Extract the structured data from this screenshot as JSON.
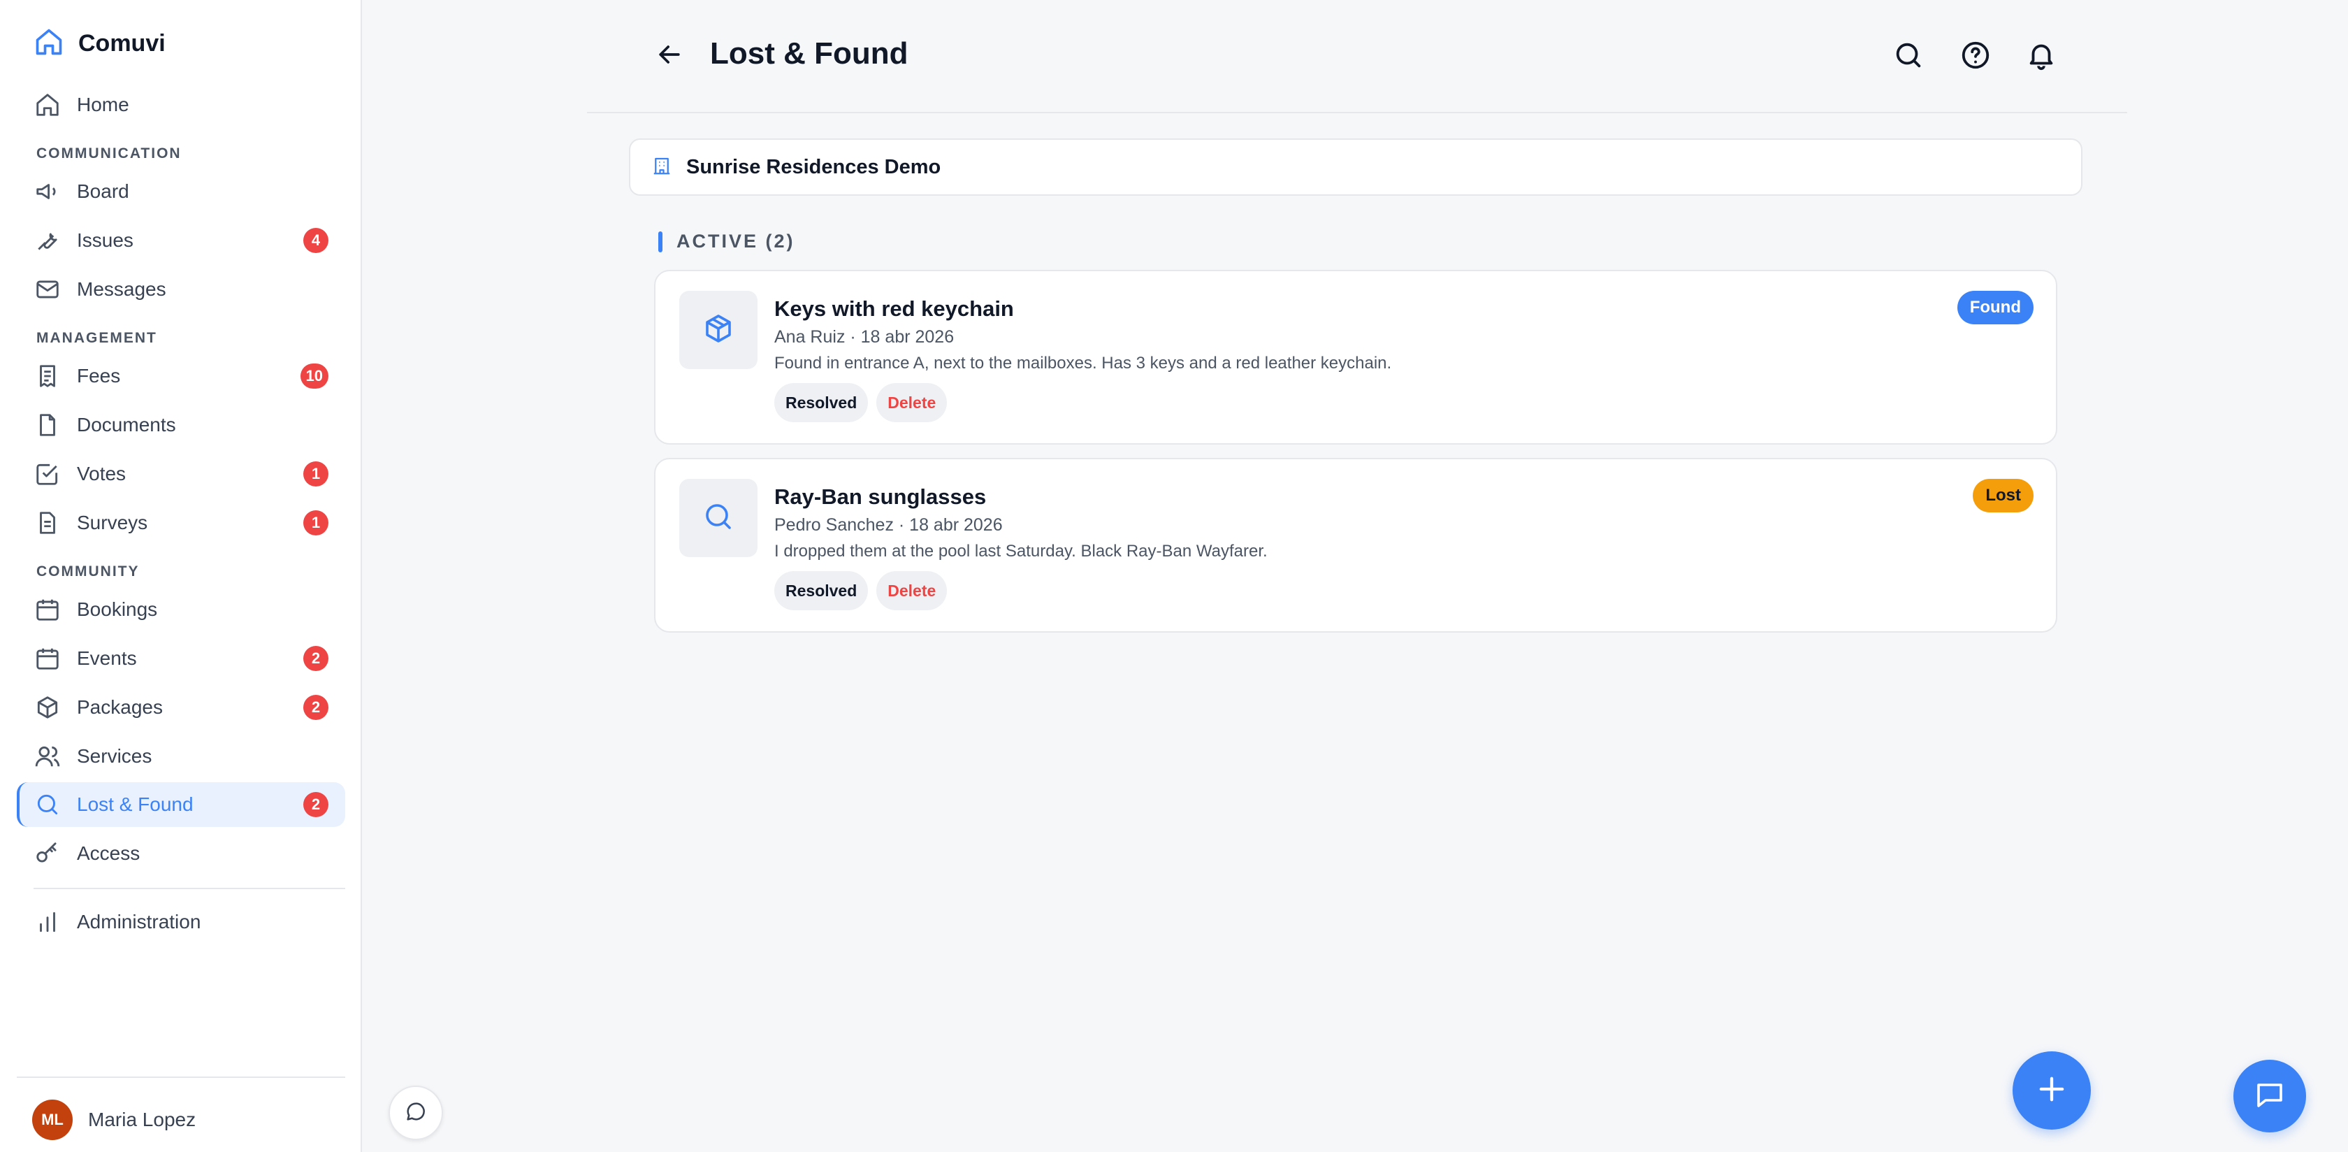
{
  "app": {
    "name": "Comuvi"
  },
  "sidebar": {
    "home": {
      "label": "Home",
      "icon": "home-icon"
    },
    "sections": {
      "communication": "COMMUNICATION",
      "management": "MANAGEMENT",
      "community": "COMMUNITY"
    },
    "items": {
      "board": {
        "label": "Board",
        "icon": "megaphone-icon"
      },
      "issues": {
        "label": "Issues",
        "badge": "4",
        "icon": "wrench-icon"
      },
      "messages": {
        "label": "Messages",
        "icon": "mail-icon"
      },
      "fees": {
        "label": "Fees",
        "badge": "10",
        "icon": "receipt-icon"
      },
      "documents": {
        "label": "Documents",
        "icon": "document-icon"
      },
      "votes": {
        "label": "Votes",
        "badge": "1",
        "icon": "checkbox-icon"
      },
      "surveys": {
        "label": "Surveys",
        "badge": "1",
        "icon": "clipboard-icon"
      },
      "bookings": {
        "label": "Bookings",
        "icon": "calendar-icon"
      },
      "events": {
        "label": "Events",
        "badge": "2",
        "icon": "calendar-icon"
      },
      "packages": {
        "label": "Packages",
        "badge": "2",
        "icon": "package-icon"
      },
      "services": {
        "label": "Services",
        "icon": "users-icon"
      },
      "lost_found": {
        "label": "Lost & Found",
        "badge": "2",
        "icon": "search-icon",
        "active": true
      },
      "access": {
        "label": "Access",
        "icon": "key-icon"
      },
      "administration": {
        "label": "Administration",
        "icon": "bar-chart-icon"
      }
    },
    "user": {
      "initials": "ML",
      "name": "Maria Lopez"
    }
  },
  "header": {
    "title": "Lost & Found",
    "icons": [
      "search-icon",
      "help-icon",
      "bell-icon"
    ]
  },
  "community": {
    "name": "Sunrise Residences Demo"
  },
  "section": {
    "title": "ACTIVE (2)"
  },
  "items": [
    {
      "title": "Keys with red keychain",
      "meta": "Ana Ruiz · 18 abr 2026",
      "description": "Found in entrance A, next to the mailboxes. Has 3 keys and a red leather keychain.",
      "status": "Found",
      "icon": "package-icon",
      "resolve_label": "Resolved",
      "delete_label": "Delete"
    },
    {
      "title": "Ray-Ban sunglasses",
      "meta": "Pedro Sanchez · 18 abr 2026",
      "description": "I dropped them at the pool last Saturday. Black Ray-Ban Wayfarer.",
      "status": "Lost",
      "icon": "search-icon",
      "resolve_label": "Resolved",
      "delete_label": "Delete"
    }
  ],
  "colors": {
    "accent": "#3b82f6",
    "badge": "#ef4444",
    "lost": "#f59e0b",
    "avatar": "#c2410c"
  }
}
